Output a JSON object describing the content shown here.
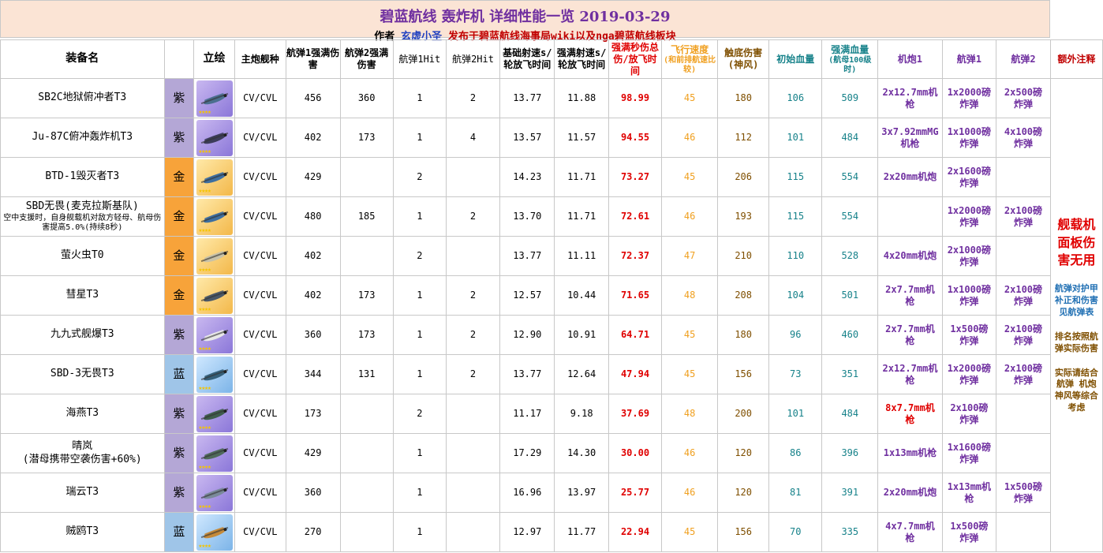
{
  "title": "碧蓝航线 轰炸机 详细性能一览 2019-03-29",
  "subtitle": {
    "author_label": "作者",
    "author_name": "玄虚小圣",
    "publish_text": "发布于碧蓝航线海事局wiki以及nga碧蓝航线板块"
  },
  "headers": {
    "name": "装备名",
    "portrait": "立绘",
    "ship_type": "主炮舰种",
    "bomb1_dmg": "航弹1强满伤害",
    "bomb2_dmg": "航弹2强满伤害",
    "bomb1_hit": "航弹1Hit",
    "bomb2_hit": "航弹2Hit",
    "base_rate": "基础射速s/轮放飞时间",
    "max_rate": "强满射速s/轮放飞时间",
    "dps": "强满秒伤总伤/放飞时间",
    "speed": "飞行速度",
    "speed_note": "(和前排航速比较)",
    "bottom_dmg": "触底伤害(神风)",
    "init_hp": "初始血量",
    "max_hp": "强满血量",
    "max_hp_note": "(航母100级时)",
    "gun": "机炮1",
    "bomb1": "航弹1",
    "bomb2": "航弹2",
    "notes": "额外注释"
  },
  "notes": {
    "main": "舰载机面板伤害无用",
    "blue": "航弹对护甲补正和伤害见航弹表",
    "brown1": "排名按照航弹实际伤害",
    "brown2": "实际请结合航弹 机炮 神风等综合考虑"
  },
  "rows": [
    {
      "name": "SB2C地狱俯冲者T3",
      "sub": "",
      "rarity": "紫",
      "rc": "purple",
      "type": "CV/CVL",
      "b1": "456",
      "b2": "360",
      "h1": "1",
      "h2": "2",
      "base": "13.77",
      "max": "11.88",
      "dps": "98.99",
      "spd": "45",
      "bottom": "180",
      "ihp": "106",
      "mhp": "509",
      "gun": "2x12.7mm机枪",
      "bomb1": "1x2000磅炸弹",
      "bomb2": "2x500磅炸弹"
    },
    {
      "name": "Ju-87C俯冲轰炸机T3",
      "sub": "",
      "rarity": "紫",
      "rc": "purple",
      "type": "CV/CVL",
      "b1": "402",
      "b2": "173",
      "h1": "1",
      "h2": "4",
      "base": "13.57",
      "max": "11.57",
      "dps": "94.55",
      "spd": "46",
      "bottom": "112",
      "ihp": "101",
      "mhp": "484",
      "gun": "3x7.92mmMG机枪",
      "bomb1": "1x1000磅炸弹",
      "bomb2": "4x100磅炸弹"
    },
    {
      "name": "BTD-1毁灭者T3",
      "sub": "",
      "rarity": "金",
      "rc": "gold",
      "type": "CV/CVL",
      "b1": "429",
      "b2": "",
      "h1": "2",
      "h2": "",
      "base": "14.23",
      "max": "11.71",
      "dps": "73.27",
      "spd": "45",
      "bottom": "206",
      "ihp": "115",
      "mhp": "554",
      "gun": "2x20mm机炮",
      "bomb1": "2x1600磅炸弹",
      "bomb2": ""
    },
    {
      "name": "SBD无畏(麦克拉斯基队)",
      "sub": "空中支援时，自身舰载机对敌方轻母、航母伤害提高5.0%(持续8秒)",
      "rarity": "金",
      "rc": "gold",
      "type": "CV/CVL",
      "b1": "480",
      "b2": "185",
      "h1": "1",
      "h2": "2",
      "base": "13.70",
      "max": "11.71",
      "dps": "72.61",
      "spd": "46",
      "bottom": "193",
      "ihp": "115",
      "mhp": "554",
      "gun": "",
      "bomb1": "1x2000磅炸弹",
      "bomb2": "2x100磅炸弹"
    },
    {
      "name": "萤火虫T0",
      "sub": "",
      "rarity": "金",
      "rc": "gold",
      "type": "CV/CVL",
      "b1": "402",
      "b2": "",
      "h1": "2",
      "h2": "",
      "base": "13.77",
      "max": "11.11",
      "dps": "72.37",
      "spd": "47",
      "bottom": "210",
      "ihp": "110",
      "mhp": "528",
      "gun": "4x20mm机炮",
      "bomb1": "2x1000磅炸弹",
      "bomb2": ""
    },
    {
      "name": "彗星T3",
      "sub": "",
      "rarity": "金",
      "rc": "gold",
      "type": "CV/CVL",
      "b1": "402",
      "b2": "173",
      "h1": "1",
      "h2": "2",
      "base": "12.57",
      "max": "10.44",
      "dps": "71.65",
      "spd": "48",
      "bottom": "208",
      "ihp": "104",
      "mhp": "501",
      "gun": "2x7.7mm机枪",
      "bomb1": "1x1000磅炸弹",
      "bomb2": "2x100磅炸弹"
    },
    {
      "name": "九九式舰爆T3",
      "sub": "",
      "rarity": "紫",
      "rc": "purple",
      "type": "CV/CVL",
      "b1": "360",
      "b2": "173",
      "h1": "1",
      "h2": "2",
      "base": "12.90",
      "max": "10.91",
      "dps": "64.71",
      "spd": "45",
      "bottom": "180",
      "ihp": "96",
      "mhp": "460",
      "gun": "2x7.7mm机枪",
      "bomb1": "1x500磅炸弹",
      "bomb2": "2x100磅炸弹"
    },
    {
      "name": "SBD-3无畏T3",
      "sub": "",
      "rarity": "蓝",
      "rc": "blue",
      "type": "CV/CVL",
      "b1": "344",
      "b2": "131",
      "h1": "1",
      "h2": "2",
      "base": "13.77",
      "max": "12.64",
      "dps": "47.94",
      "spd": "45",
      "bottom": "156",
      "ihp": "73",
      "mhp": "351",
      "gun": "2x12.7mm机枪",
      "bomb1": "1x2000磅炸弹",
      "bomb2": "2x100磅炸弹"
    },
    {
      "name": "海燕T3",
      "sub": "",
      "rarity": "紫",
      "rc": "purple",
      "type": "CV/CVL",
      "b1": "173",
      "b2": "",
      "h1": "2",
      "h2": "",
      "base": "11.17",
      "max": "9.18",
      "dps": "37.69",
      "spd": "48",
      "bottom": "200",
      "ihp": "101",
      "mhp": "484",
      "gun": "8x7.7mm机枪",
      "bomb1": "2x100磅炸弹",
      "bomb2": ""
    },
    {
      "name": "晴岚",
      "sub": "(潜母携带空袭伤害+60%)",
      "rarity": "紫",
      "rc": "purple",
      "type": "CV/CVL",
      "b1": "429",
      "b2": "",
      "h1": "1",
      "h2": "",
      "base": "17.29",
      "max": "14.30",
      "dps": "30.00",
      "spd": "46",
      "bottom": "120",
      "ihp": "86",
      "mhp": "396",
      "gun": "1x13mm机枪",
      "bomb1": "1x1600磅炸弹",
      "bomb2": ""
    },
    {
      "name": "瑞云T3",
      "sub": "",
      "rarity": "紫",
      "rc": "purple",
      "type": "CV/CVL",
      "b1": "360",
      "b2": "",
      "h1": "1",
      "h2": "",
      "base": "16.96",
      "max": "13.97",
      "dps": "25.77",
      "spd": "46",
      "bottom": "120",
      "ihp": "81",
      "mhp": "391",
      "gun": "2x20mm机炮",
      "bomb1": "1x13mm机枪",
      "bomb2": "1x500磅炸弹"
    },
    {
      "name": "贼鸥T3",
      "sub": "",
      "rarity": "蓝",
      "rc": "blue",
      "type": "CV/CVL",
      "b1": "270",
      "b2": "",
      "h1": "1",
      "h2": "",
      "base": "12.97",
      "max": "11.77",
      "dps": "22.94",
      "spd": "45",
      "bottom": "156",
      "ihp": "70",
      "mhp": "335",
      "gun": "4x7.7mm机枪",
      "bomb1": "1x500磅炸弹",
      "bomb2": ""
    }
  ]
}
